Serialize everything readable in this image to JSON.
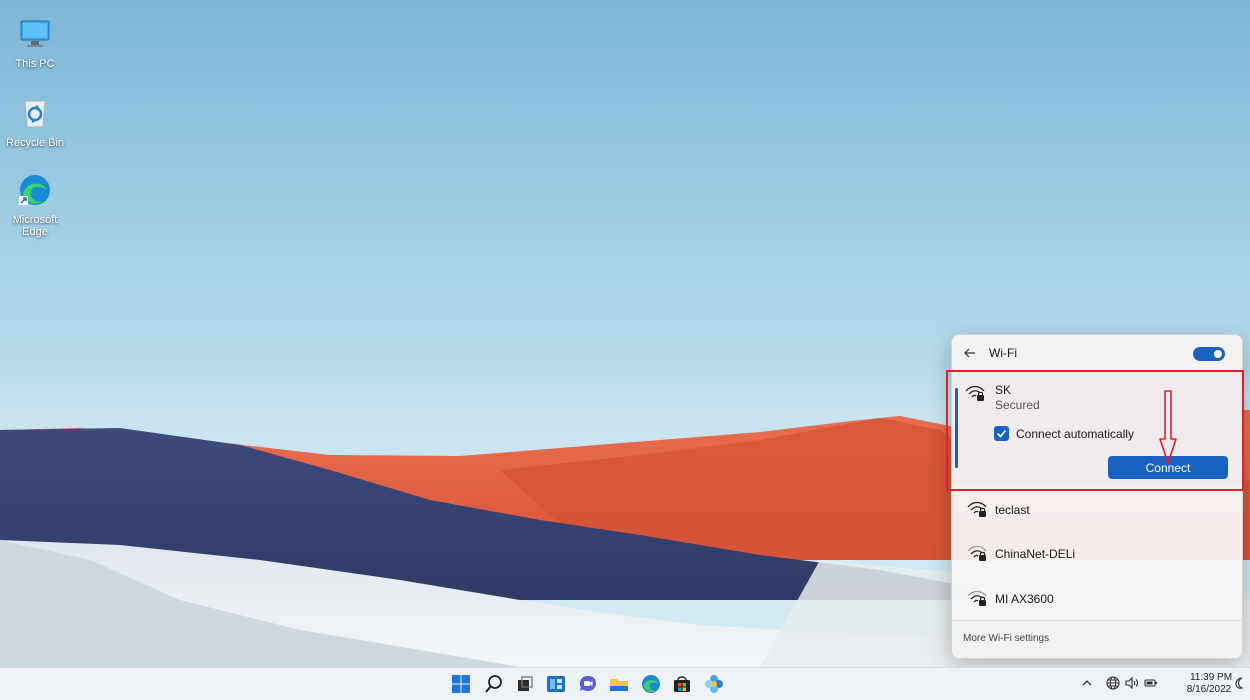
{
  "desktop": {
    "icons": [
      {
        "label": "This PC"
      },
      {
        "label": "Recycle Bin"
      },
      {
        "label": "Microsoft Edge"
      }
    ]
  },
  "wifi_panel": {
    "title": "Wi-Fi",
    "toggle_on": true,
    "selected_network": {
      "name": "SK",
      "status": "Secured",
      "auto_connect_label": "Connect automatically",
      "auto_connect_checked": true,
      "connect_label": "Connect"
    },
    "networks": [
      {
        "name": "teclast"
      },
      {
        "name": "ChinaNet-DELi"
      },
      {
        "name": "MI AX3600"
      }
    ],
    "more_settings_label": "More Wi-Fi settings"
  },
  "taskbar": {
    "icons": [
      "start-icon",
      "search-icon",
      "task-view-icon",
      "widgets-icon",
      "chat-icon",
      "file-explorer-icon",
      "edge-icon",
      "store-icon",
      "photos-icon"
    ],
    "tray": [
      "chevron-up-icon",
      "network-icon",
      "volume-icon",
      "battery-icon"
    ],
    "time": "11:39 PM",
    "date": "8/16/2022"
  },
  "colors": {
    "accent": "#1a62c2",
    "annotation": "#e0202a"
  }
}
